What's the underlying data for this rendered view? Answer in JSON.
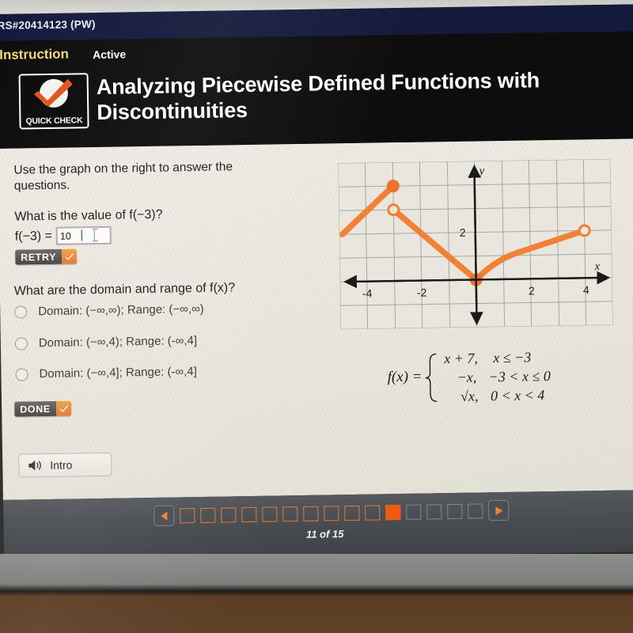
{
  "window": {
    "top_strip_text": "RS#20414123 (PW)"
  },
  "header": {
    "tab_instruction": "Instruction",
    "tab_active": "Active",
    "badge_text": "QUICK CHECK",
    "badge_icon": "orange-checkmark-icon",
    "title": "Analyzing Piecewise Defined Functions with Discontinuities"
  },
  "lesson": {
    "prompt": "Use the graph on the right to answer the questions.",
    "question1": "What is the value of f(−3)?",
    "answer_label": "f(−3) =",
    "answer_value": "10",
    "answer_placeholder": "",
    "retry_label": "RETRY",
    "question2": "What are the domain and range of f(x)?",
    "choices": [
      {
        "label": "Domain:  (−∞,∞);  Range:  (−∞,∞)",
        "selected": false
      },
      {
        "label": "Domain:  (−∞,4);  Range:  (-∞,4]",
        "selected": false
      },
      {
        "label": "Domain:  (−∞,4];  Range:  (-∞,4]",
        "selected": false
      }
    ],
    "done_label": "DONE",
    "intro_label": "Intro",
    "intro_icon": "speaker-icon"
  },
  "formula": {
    "lhs": "f(x) =",
    "pieces": [
      {
        "expr": "x + 7,",
        "condition": "x ≤ −3"
      },
      {
        "expr": "−x,",
        "condition": "−3 < x ≤ 0"
      },
      {
        "expr": "√x,",
        "condition": "0 < x < 4"
      }
    ]
  },
  "chart_data": {
    "type": "line",
    "title": "",
    "xlabel": "x",
    "ylabel": "y",
    "xlim": [
      -5,
      5
    ],
    "ylim": [
      -2,
      5
    ],
    "xticks": [
      -4,
      -2,
      2,
      4
    ],
    "xtick_labels": [
      "-4",
      "-2",
      "2",
      "4"
    ],
    "yticks": [
      2
    ],
    "ytick_labels": [
      "2"
    ],
    "grid": true,
    "legend": null,
    "axis_color": "#1a1a1a",
    "curve_color": "#ef8236",
    "grid_color": "#a9a69e",
    "series": [
      {
        "name": "x + 7, x ≤ -3",
        "type": "segment",
        "points": [
          [
            -5,
            2
          ],
          [
            -3,
            4
          ]
        ],
        "endpoint_start": "none",
        "endpoint_end": "closed"
      },
      {
        "name": "-x, -3 < x ≤ 0",
        "type": "segment",
        "points": [
          [
            -3,
            3
          ],
          [
            0,
            0
          ]
        ],
        "endpoint_start": "open",
        "endpoint_end": "closed"
      },
      {
        "name": "sqrt(x), 0 < x < 4",
        "type": "curve",
        "points": [
          [
            0,
            0
          ],
          [
            0.5,
            0.71
          ],
          [
            1,
            1
          ],
          [
            1.5,
            1.22
          ],
          [
            2,
            1.41
          ],
          [
            2.5,
            1.58
          ],
          [
            3,
            1.73
          ],
          [
            3.5,
            1.87
          ],
          [
            4,
            2
          ]
        ],
        "endpoint_start": "none",
        "endpoint_end": "open"
      }
    ],
    "markers": [
      {
        "x": -3,
        "y": 4,
        "style": "closed",
        "label": ""
      },
      {
        "x": -3,
        "y": 3,
        "style": "open",
        "label": ""
      },
      {
        "x": 0,
        "y": 0,
        "style": "closed",
        "label": ""
      },
      {
        "x": 4,
        "y": 2,
        "style": "open",
        "label": ""
      }
    ]
  },
  "nav": {
    "prev_icon": "left-arrow-icon",
    "next_icon": "right-arrow-icon",
    "total_pages": 15,
    "current_page": 11,
    "page_count_text": "11 of 15"
  },
  "colors": {
    "accent_orange": "#ef5a10",
    "curve_orange": "#ef8236",
    "navy": "#141a3c",
    "header_black": "#0d0d0d",
    "paper": "#eae7de",
    "nav_bar": "#4a4e53"
  }
}
